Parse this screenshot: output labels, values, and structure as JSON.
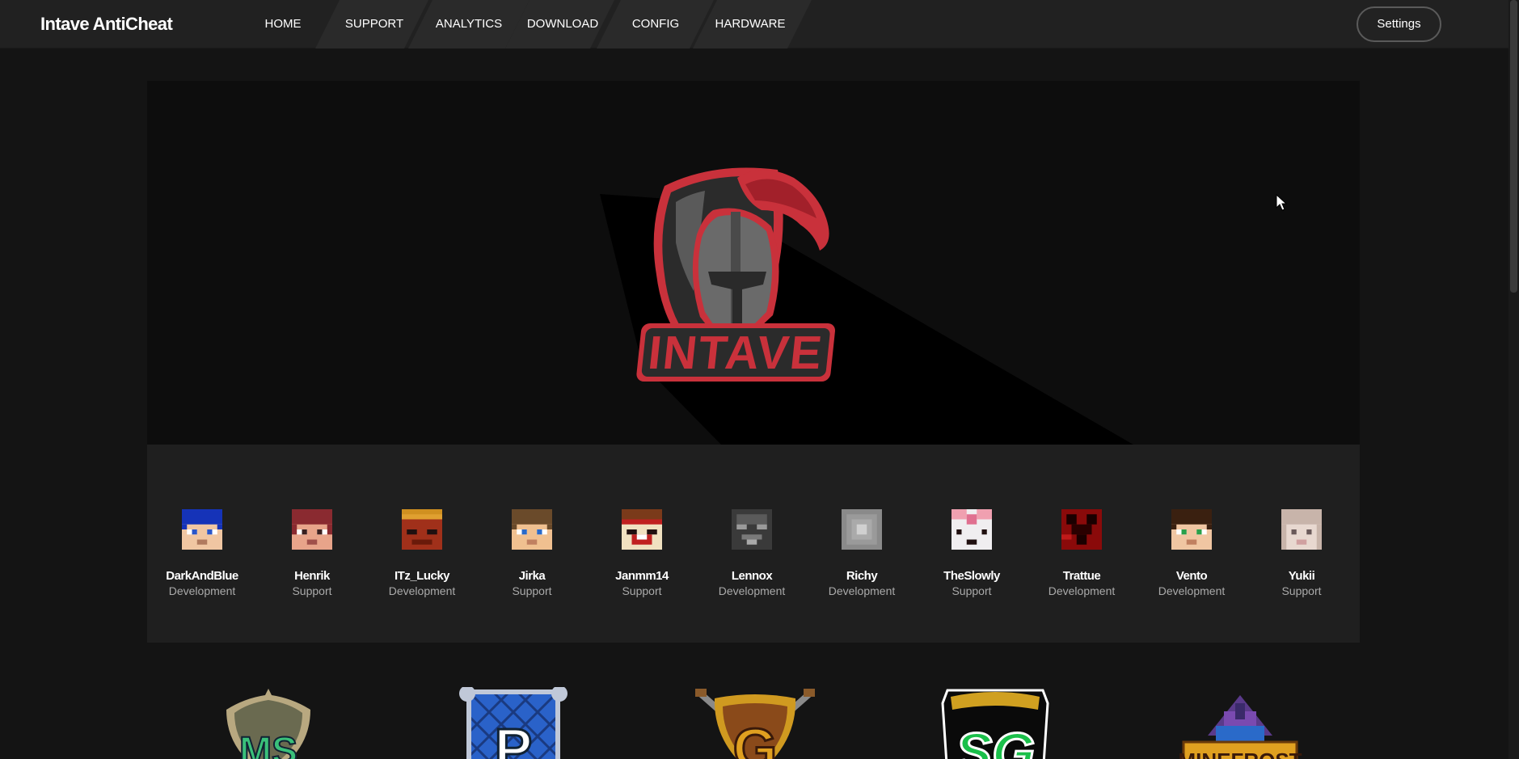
{
  "app": {
    "brand": "Intave AntiCheat",
    "settings_label": "Settings"
  },
  "nav": {
    "items": [
      {
        "label": "HOME"
      },
      {
        "label": "SUPPORT"
      },
      {
        "label": "ANALYTICS"
      },
      {
        "label": "DOWNLOAD"
      },
      {
        "label": "CONFIG"
      },
      {
        "label": "HARDWARE"
      }
    ]
  },
  "hero": {
    "logo_text": "INTAVE"
  },
  "team": {
    "members": [
      {
        "name": "DarkAndBlue",
        "role": "Development"
      },
      {
        "name": "Henrik",
        "role": "Support"
      },
      {
        "name": "ITz_Lucky",
        "role": "Development"
      },
      {
        "name": "Jirka",
        "role": "Support"
      },
      {
        "name": "Janmm14",
        "role": "Support"
      },
      {
        "name": "Lennox",
        "role": "Development"
      },
      {
        "name": "Richy",
        "role": "Development"
      },
      {
        "name": "TheSlowly",
        "role": "Support"
      },
      {
        "name": "Trattue",
        "role": "Development"
      },
      {
        "name": "Vento",
        "role": "Development"
      },
      {
        "name": "Yukii",
        "role": "Support"
      }
    ]
  },
  "partners": {
    "logos": [
      {
        "text": "MS"
      },
      {
        "text": "P"
      },
      {
        "text": "G"
      },
      {
        "text": "SG"
      },
      {
        "text": "MINEFROST"
      }
    ]
  },
  "colors": {
    "background": "#141414",
    "navbar": "#212121",
    "accent_red": "#c9313b",
    "team_panel": "#1f1f1f"
  }
}
